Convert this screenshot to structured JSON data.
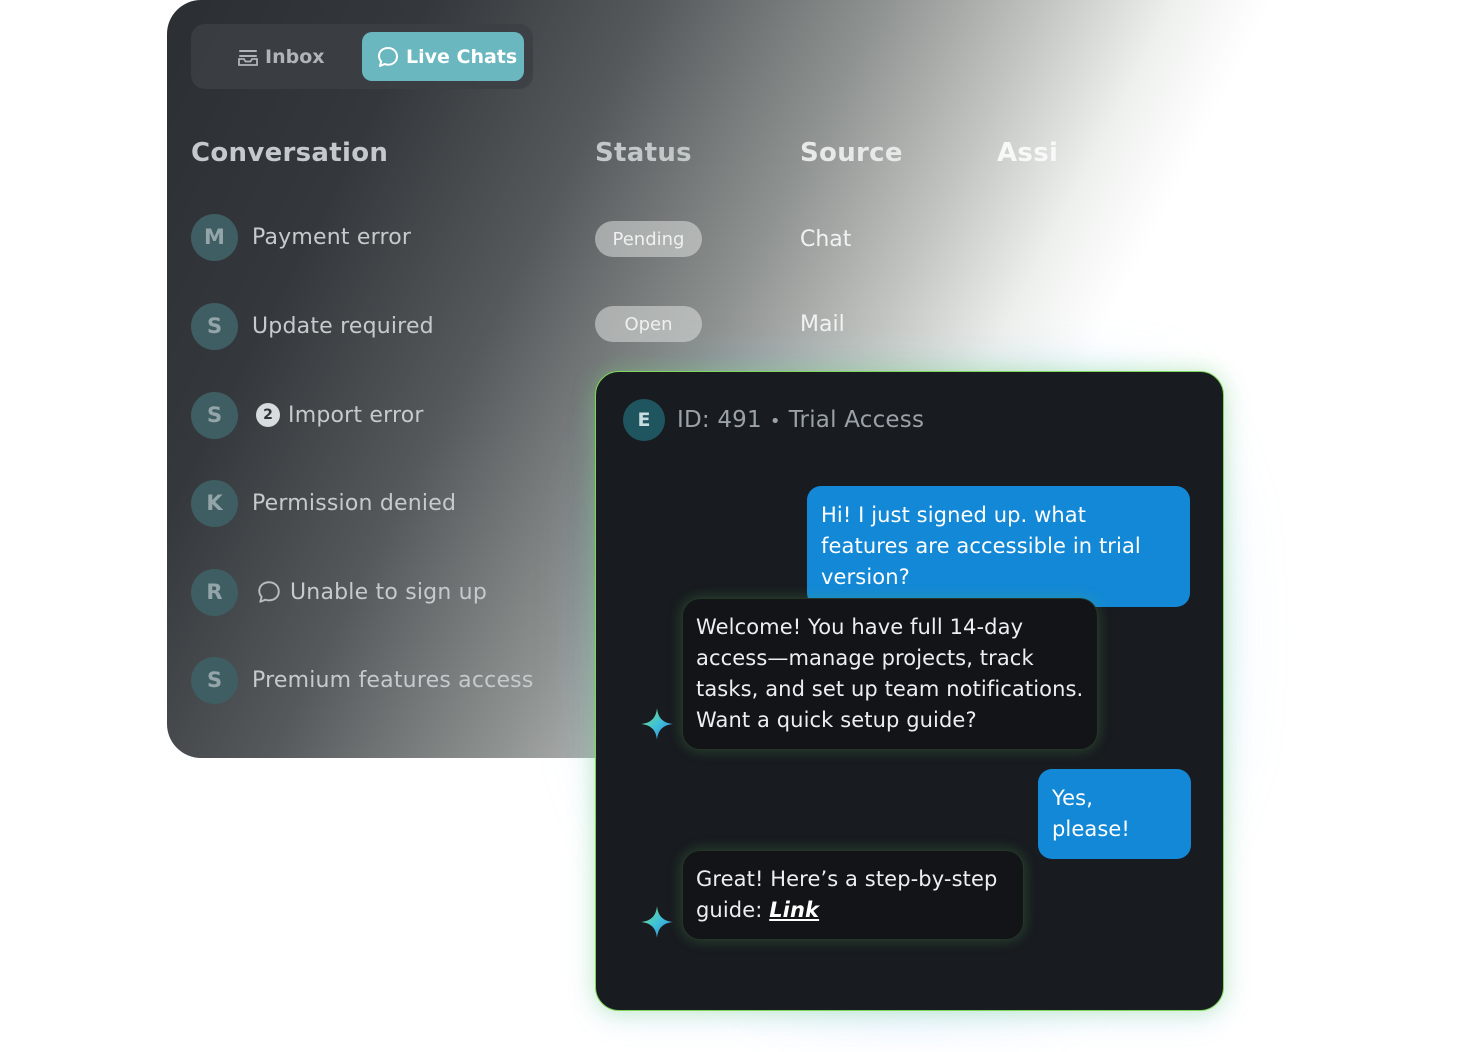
{
  "tabs": [
    {
      "label": "Inbox",
      "icon": "inbox-icon",
      "active": false
    },
    {
      "label": "Live Chats",
      "icon": "chat-bubble-icon",
      "active": true
    }
  ],
  "table": {
    "columns": [
      "Conversation",
      "Status",
      "Source",
      "Assi"
    ],
    "rows": [
      {
        "initial": "M",
        "title": "Payment error",
        "status": "Pending",
        "source": "Chat"
      },
      {
        "initial": "S",
        "title": "Update required",
        "status": "Open",
        "source": "Mail"
      },
      {
        "initial": "S",
        "title": "Import error",
        "badge": "2"
      },
      {
        "initial": "K",
        "title": "Permission denied"
      },
      {
        "initial": "R",
        "title": "Unable to sign up",
        "icon": "chat-bubble-icon"
      },
      {
        "initial": "S",
        "title": "Premium features access"
      }
    ]
  },
  "chat": {
    "avatar": "E",
    "id_label": "ID: 491",
    "separator": "•",
    "topic": "Trial Access",
    "messages": [
      {
        "from": "user",
        "text": "Hi! I just signed up. what features are accessible in trial version?"
      },
      {
        "from": "bot",
        "text": "Welcome! You have full 14-day access—manage projects, track tasks, and set up team notifications. Want a quick setup guide?"
      },
      {
        "from": "user",
        "text": "Yes, please!"
      },
      {
        "from": "bot",
        "text": "Great! Here’s a step-by-step guide:",
        "link": "Link"
      }
    ]
  },
  "colors": {
    "active_tab": "#6ab7bf",
    "user_bubble": "#1388d6",
    "chat_border": "#7fd65a",
    "chat_background": "#181b20"
  }
}
